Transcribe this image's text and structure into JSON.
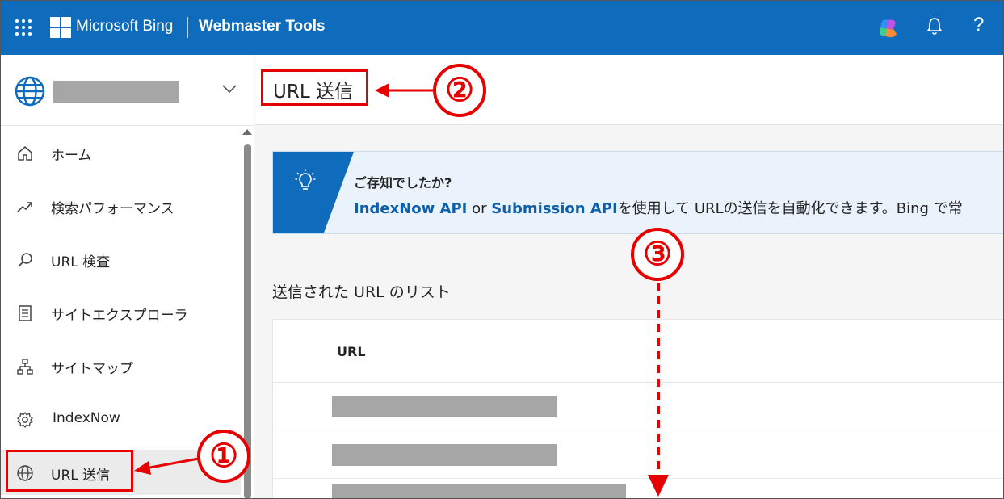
{
  "header": {
    "brand": "Microsoft Bing",
    "product": "Webmaster Tools",
    "help_label": "?",
    "accent_color": "#0f6cbd"
  },
  "sidebar": {
    "items": [
      {
        "label": "ホーム",
        "icon": "home-icon"
      },
      {
        "label": "検索パフォーマンス",
        "icon": "trend-icon"
      },
      {
        "label": "URL 検査",
        "icon": "search-icon"
      },
      {
        "label": "サイトエクスプローラ",
        "icon": "document-list-icon"
      },
      {
        "label": "サイトマップ",
        "icon": "sitemap-icon"
      },
      {
        "label": "IndexNow",
        "icon": "gear-icon"
      },
      {
        "label": "URL 送信",
        "icon": "globe-icon",
        "selected": true
      }
    ]
  },
  "main": {
    "page_title": "URL 送信",
    "banner": {
      "title": "ご存知でしたか?",
      "link1": "IndexNow API",
      "or_text": " or ",
      "link2": "Submission API",
      "rest": "を使用して URLの送信を自動化できます。Bing で常"
    },
    "list_heading": "送信された URL のリスト",
    "table": {
      "column_header": "URL"
    }
  },
  "annotations": {
    "one": "①",
    "two": "②",
    "three": "③",
    "color": "#e60000"
  }
}
